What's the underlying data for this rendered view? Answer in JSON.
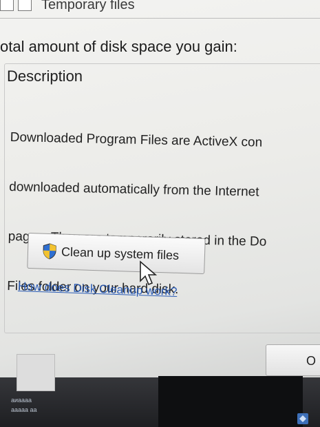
{
  "window": {
    "top_item_label": "Temporary files",
    "total_label": "otal amount of disk space you gain:"
  },
  "description": {
    "title": "Description",
    "text_lines": [
      "Downloaded Program Files are ActiveX con",
      "downloaded automatically from the Internet",
      "pages. They are temporarily stored in the Do",
      "Files folder on your hard disk."
    ]
  },
  "buttons": {
    "cleanup_label": "Clean up system files",
    "ok_label": "O"
  },
  "link": {
    "text": "How does Disk Cleanup work?"
  },
  "taskbar": {
    "text_line1": "аиаааа",
    "text_line2": "ааааа аа"
  },
  "colors": {
    "link": "#2a5bb5",
    "shield_blue": "#2f6fd0",
    "shield_yellow": "#f2c230"
  }
}
